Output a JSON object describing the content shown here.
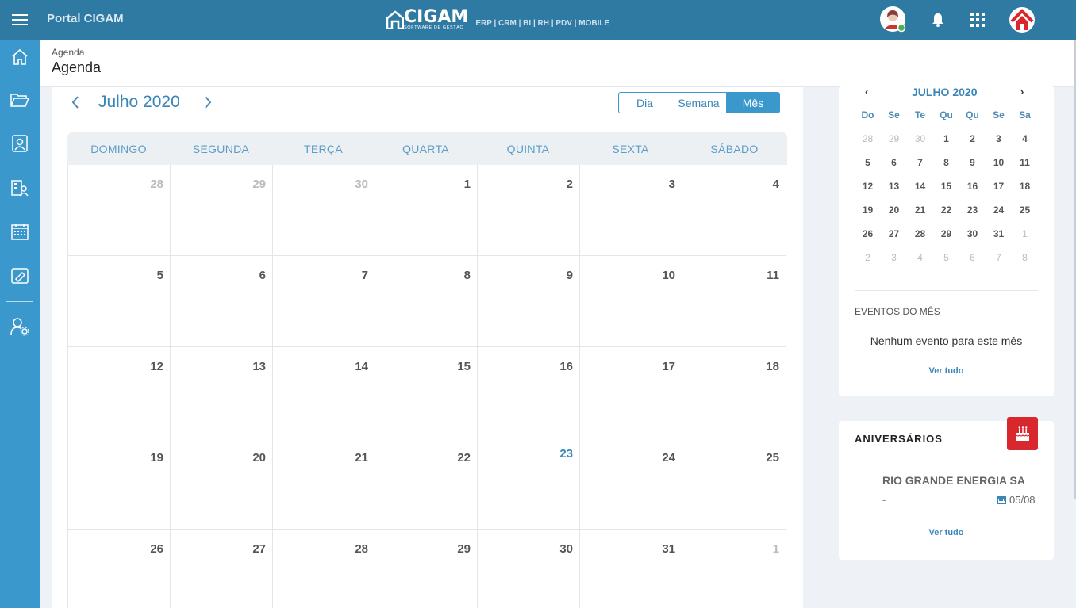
{
  "topbar": {
    "portal_title": "Portal CIGAM",
    "brand_name": "CIGAM",
    "brand_tagline": "SOFTWARE DE GESTÃO",
    "modules": "ERP | CRM | BI | RH | PDV | MOBILE",
    "bar_color": "#2f7aa3"
  },
  "sidebar": {
    "color": "#3a98cc",
    "items": [
      "home-icon",
      "folder-icon",
      "contacts-icon",
      "directory-icon",
      "calendar-icon",
      "ticket-icon",
      "user-settings-icon"
    ]
  },
  "header": {
    "breadcrumb": "Agenda",
    "title": "Agenda"
  },
  "calendar": {
    "month_label": "Julho 2020",
    "prev": "‹",
    "next": "›",
    "views": [
      "Dia",
      "Semana",
      "Mês"
    ],
    "active_view": "Mês",
    "weekdays": [
      "DOMINGO",
      "SEGUNDA",
      "TERÇA",
      "QUARTA",
      "QUINTA",
      "SEXTA",
      "SÁBADO"
    ],
    "weeks": [
      [
        {
          "d": "28",
          "o": true
        },
        {
          "d": "29",
          "o": true
        },
        {
          "d": "30",
          "o": true
        },
        {
          "d": "1"
        },
        {
          "d": "2"
        },
        {
          "d": "3"
        },
        {
          "d": "4"
        }
      ],
      [
        {
          "d": "5"
        },
        {
          "d": "6"
        },
        {
          "d": "7"
        },
        {
          "d": "8"
        },
        {
          "d": "9"
        },
        {
          "d": "10"
        },
        {
          "d": "11"
        }
      ],
      [
        {
          "d": "12"
        },
        {
          "d": "13"
        },
        {
          "d": "14"
        },
        {
          "d": "15"
        },
        {
          "d": "16"
        },
        {
          "d": "17"
        },
        {
          "d": "18"
        }
      ],
      [
        {
          "d": "19"
        },
        {
          "d": "20"
        },
        {
          "d": "21"
        },
        {
          "d": "22"
        },
        {
          "d": "23",
          "t": true
        },
        {
          "d": "24"
        },
        {
          "d": "25"
        }
      ],
      [
        {
          "d": "26"
        },
        {
          "d": "27"
        },
        {
          "d": "28"
        },
        {
          "d": "29"
        },
        {
          "d": "30"
        },
        {
          "d": "31"
        },
        {
          "d": "1",
          "o": true
        }
      ]
    ]
  },
  "mini_calendar": {
    "title": "JULHO 2020",
    "prev": "‹",
    "next": "›",
    "dow": [
      "Do",
      "Se",
      "Te",
      "Qu",
      "Qu",
      "Se",
      "Sa"
    ],
    "days": [
      {
        "d": "28",
        "o": true
      },
      {
        "d": "29",
        "o": true
      },
      {
        "d": "30",
        "o": true
      },
      {
        "d": "1"
      },
      {
        "d": "2"
      },
      {
        "d": "3"
      },
      {
        "d": "4"
      },
      {
        "d": "5"
      },
      {
        "d": "6"
      },
      {
        "d": "7"
      },
      {
        "d": "8"
      },
      {
        "d": "9"
      },
      {
        "d": "10"
      },
      {
        "d": "11"
      },
      {
        "d": "12"
      },
      {
        "d": "13"
      },
      {
        "d": "14"
      },
      {
        "d": "15"
      },
      {
        "d": "16"
      },
      {
        "d": "17"
      },
      {
        "d": "18"
      },
      {
        "d": "19"
      },
      {
        "d": "20"
      },
      {
        "d": "21"
      },
      {
        "d": "22"
      },
      {
        "d": "23"
      },
      {
        "d": "24"
      },
      {
        "d": "25"
      },
      {
        "d": "26"
      },
      {
        "d": "27"
      },
      {
        "d": "28"
      },
      {
        "d": "29"
      },
      {
        "d": "30"
      },
      {
        "d": "31"
      },
      {
        "d": "1",
        "o": true
      },
      {
        "d": "2",
        "o": true
      },
      {
        "d": "3",
        "o": true
      },
      {
        "d": "4",
        "o": true
      },
      {
        "d": "5",
        "o": true
      },
      {
        "d": "6",
        "o": true
      },
      {
        "d": "7",
        "o": true
      },
      {
        "d": "8",
        "o": true
      }
    ],
    "events_title": "EVENTOS DO MÊS",
    "events_empty": "Nenhum evento para este mês",
    "see_all": "Ver tudo"
  },
  "birthdays": {
    "title": "ANIVERSÁRIOS",
    "badge_color": "#d9272e",
    "name": "RIO GRANDE ENERGIA SA",
    "detail": "-",
    "date": "05/08",
    "see_all": "Ver tudo"
  }
}
